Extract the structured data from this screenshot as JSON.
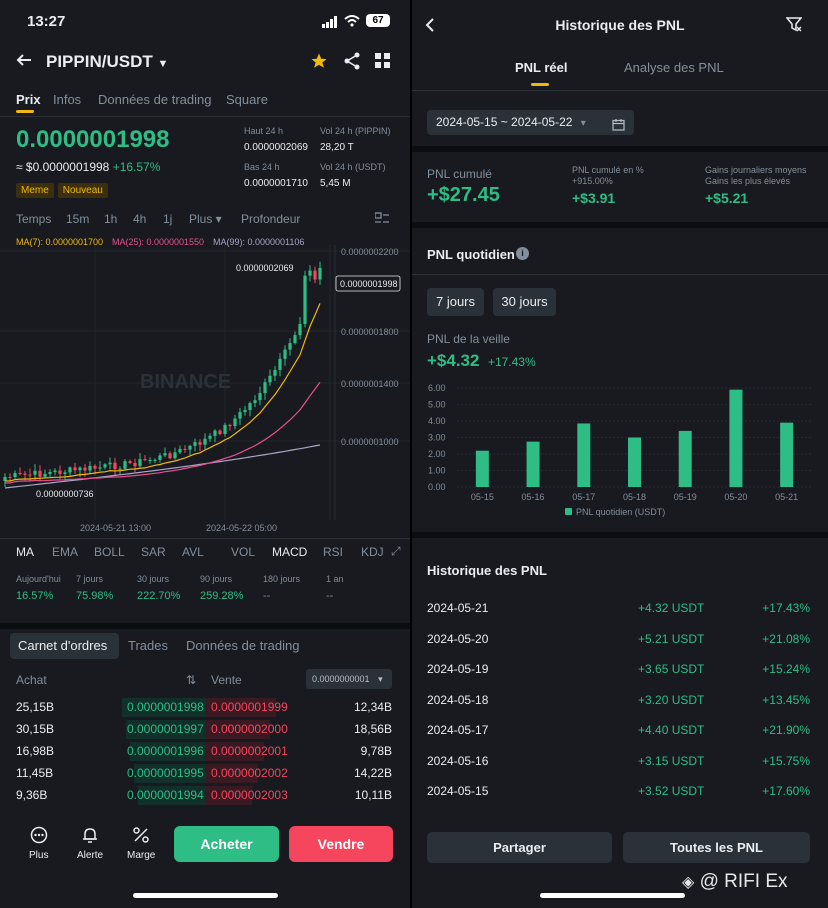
{
  "left": {
    "status": {
      "time": "13:27",
      "battery": "67"
    },
    "header": {
      "pair": "PIPPIN/USDT"
    },
    "tabs": [
      "Prix",
      "Infos",
      "Données de trading",
      "Square"
    ],
    "price": {
      "last": "0.0000001998",
      "fiat": "≈ $0.0000001998",
      "change": "+16.57%",
      "tags": [
        "Meme",
        "Nouveau"
      ],
      "stats": [
        {
          "label": "Haut 24 h",
          "value": "0.0000002069"
        },
        {
          "label": "Vol 24 h (PIPPIN)",
          "value": "28,20 T"
        },
        {
          "label": "Bas 24 h",
          "value": "0.0000001710"
        },
        {
          "label": "Vol 24 h (USDT)",
          "value": "5,45 M"
        }
      ]
    },
    "intervals": [
      "Temps",
      "15m",
      "1h",
      "4h",
      "1j",
      "Plus ▾",
      "Profondeur"
    ],
    "ma": {
      "ma7": "MA(7): 0.0000001700",
      "ma25": "MA(25): 0.0000001550",
      "ma99": "MA(99): 0.0000001106"
    },
    "chart": {
      "watermark": "BINANCE",
      "axis": [
        "0.0000002200",
        "0.0000001800",
        "0.0000001400",
        "0.0000001000"
      ],
      "high_label": "0.0000002069",
      "last_label": "0.0000001998",
      "low_label": "0.0000000736",
      "dates": [
        "2024-05-21 13:00",
        "2024-05-22 05:00"
      ]
    },
    "indicators": [
      "MA",
      "EMA",
      "BOLL",
      "SAR",
      "AVL",
      "VOL",
      "MACD",
      "RSI",
      "KDJ"
    ],
    "perf": [
      {
        "label": "Aujourd'hui",
        "value": "16.57%"
      },
      {
        "label": "7 jours",
        "value": "75.98%"
      },
      {
        "label": "30 jours",
        "value": "222.70%"
      },
      {
        "label": "90 jours",
        "value": "259.28%"
      },
      {
        "label": "180 jours",
        "value": "--"
      },
      {
        "label": "1 an",
        "value": "--"
      }
    ],
    "book_tabs": [
      "Carnet d'ordres",
      "Trades",
      "Données de trading"
    ],
    "book_header": {
      "buy": "Achat",
      "sell": "Vente",
      "precision": "0.0000000001"
    },
    "book": [
      {
        "bq": "25,15B",
        "bp": "0.0000001998",
        "ap": "0.0000001999",
        "aq": "12,34B"
      },
      {
        "bq": "30,15B",
        "bp": "0.0000001997",
        "ap": "0.0000002000",
        "aq": "18,56B"
      },
      {
        "bq": "16,98B",
        "bp": "0.0000001996",
        "ap": "0.0000002001",
        "aq": "9,78B"
      },
      {
        "bq": "11,45B",
        "bp": "0.0000001995",
        "ap": "0.0000002002",
        "aq": "14,22B"
      },
      {
        "bq": "9,36B",
        "bp": "0.0000001994",
        "ap": "0.0000002003",
        "aq": "10,11B"
      }
    ],
    "bottom": {
      "plus": "Plus",
      "alert": "Alerte",
      "margin": "Marge",
      "buy": "Acheter",
      "sell": "Vendre"
    }
  },
  "right": {
    "title": "Historique des PNL",
    "tabs": [
      "PNL réel",
      "Analyse des PNL"
    ],
    "date_range": "2024-05-15 ~ 2024-05-22",
    "summary": [
      {
        "label": "PNL cumulé",
        "value": "+$27.45"
      },
      {
        "label": "PNL cumulé en %",
        "sub": "+915.00%",
        "value": "+$3.91"
      },
      {
        "label": "Gains journaliers moyens",
        "sub": "Gains les plus élevés",
        "value": "+$5.21"
      }
    ],
    "daily_title": "PNL quotidien",
    "periods": [
      "7 jours",
      "30 jours"
    ],
    "prev_label": "PNL de la veille",
    "prev_value": "+$4.32",
    "prev_pct": "+17.43%",
    "history_title": "Historique des PNL",
    "history": [
      {
        "date": "2024-05-21",
        "amount": "+4.32 USDT",
        "pct": "+17.43%"
      },
      {
        "date": "2024-05-20",
        "amount": "+5.21 USDT",
        "pct": "+21.08%"
      },
      {
        "date": "2024-05-19",
        "amount": "+3.65 USDT",
        "pct": "+15.24%"
      },
      {
        "date": "2024-05-18",
        "amount": "+3.20 USDT",
        "pct": "+13.45%"
      },
      {
        "date": "2024-05-17",
        "amount": "+4.40 USDT",
        "pct": "+21.90%"
      },
      {
        "date": "2024-05-16",
        "amount": "+3.15 USDT",
        "pct": "+15.75%"
      },
      {
        "date": "2024-05-15",
        "amount": "+3.52 USDT",
        "pct": "+17.60%"
      }
    ],
    "share": "Partager",
    "all_pnl": "Toutes les PNL",
    "watermark": "@ RIFI  Ex"
  },
  "chart_data": {
    "type": "bar",
    "categories": [
      "05-15",
      "05-16",
      "05-17",
      "05-18",
      "05-19",
      "05-20",
      "05-21"
    ],
    "series": [
      {
        "name": "PNL quotidien (USDT)",
        "values": [
          2.2,
          2.75,
          3.85,
          3.0,
          3.4,
          5.9,
          3.9
        ]
      }
    ],
    "ylim": [
      0,
      6
    ],
    "yticks": [
      "6.00",
      "5.00",
      "4.00",
      "3.00",
      "2.00",
      "1.00",
      "0.00"
    ],
    "legend": "bottom",
    "color": "#2ebd85"
  },
  "colors": {
    "up": "#2ebd85",
    "down": "#f6465d",
    "accent": "#f0b90b",
    "bg": "#181a20"
  }
}
